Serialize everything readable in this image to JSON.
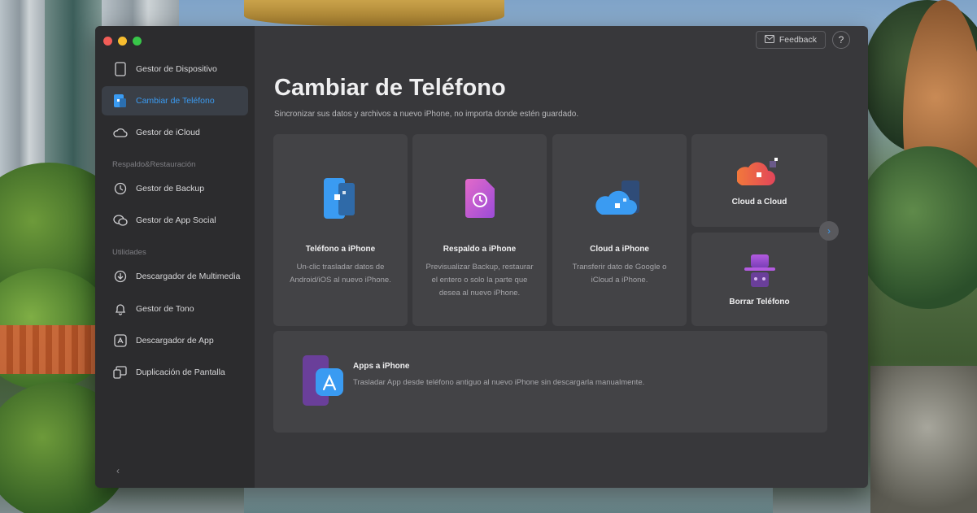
{
  "window": {
    "feedback_label": "Feedback",
    "help_label": "?"
  },
  "sidebar": {
    "items": [
      {
        "label": "Gestor de Dispositivo",
        "icon": "phone-outline-icon"
      },
      {
        "label": "Cambiar de Teléfono",
        "icon": "phone-transfer-icon",
        "active": true
      },
      {
        "label": "Gestor de iCloud",
        "icon": "cloud-icon"
      }
    ],
    "section_backup": "Respaldo&Restauración",
    "backup_items": [
      {
        "label": "Gestor de Backup",
        "icon": "backup-clock-icon"
      },
      {
        "label": "Gestor de App Social",
        "icon": "chat-bubbles-icon"
      }
    ],
    "section_utilities": "Utilidades",
    "utility_items": [
      {
        "label": "Descargador de Multimedia",
        "icon": "download-circle-icon"
      },
      {
        "label": "Gestor de Tono",
        "icon": "bell-icon"
      },
      {
        "label": "Descargador de App",
        "icon": "app-store-icon"
      },
      {
        "label": "Duplicación de Pantalla",
        "icon": "screen-mirror-icon"
      }
    ],
    "collapse_label": "‹"
  },
  "main": {
    "title": "Cambiar de Teléfono",
    "subtitle": "Sincronizar sus datos y archivos a nuevo iPhone, no importa donde estén guardado.",
    "cards": [
      {
        "title": "Teléfono a iPhone",
        "desc": "Un-clic trasladar datos de Android/iOS al nuevo iPhone.",
        "icon": "phone-to-phone-icon"
      },
      {
        "title": "Respaldo a iPhone",
        "desc": "Previsualizar Backup, restaurar el entero o solo la parte que desea al nuevo iPhone.",
        "icon": "backup-file-icon"
      },
      {
        "title": "Cloud a iPhone",
        "desc": "Transferir dato de Google o iCloud a iPhone.",
        "icon": "cloud-phone-icon"
      },
      {
        "title": "Cloud a Cloud",
        "icon": "cloud-to-cloud-icon"
      },
      {
        "title": "Borrar Teléfono",
        "icon": "incognito-icon"
      }
    ],
    "next_arrow": "›",
    "apps_card": {
      "title": "Apps a iPhone",
      "desc": "Trasladar App desde teléfono antiguo al nuevo iPhone sin descargarla manualmente.",
      "icon": "app-store-phone-icon"
    }
  },
  "colors": {
    "window_bg": "#38383b",
    "sidebar_bg": "#2c2c2e",
    "card_bg": "#434346",
    "accent_blue": "#3a9bf2"
  }
}
